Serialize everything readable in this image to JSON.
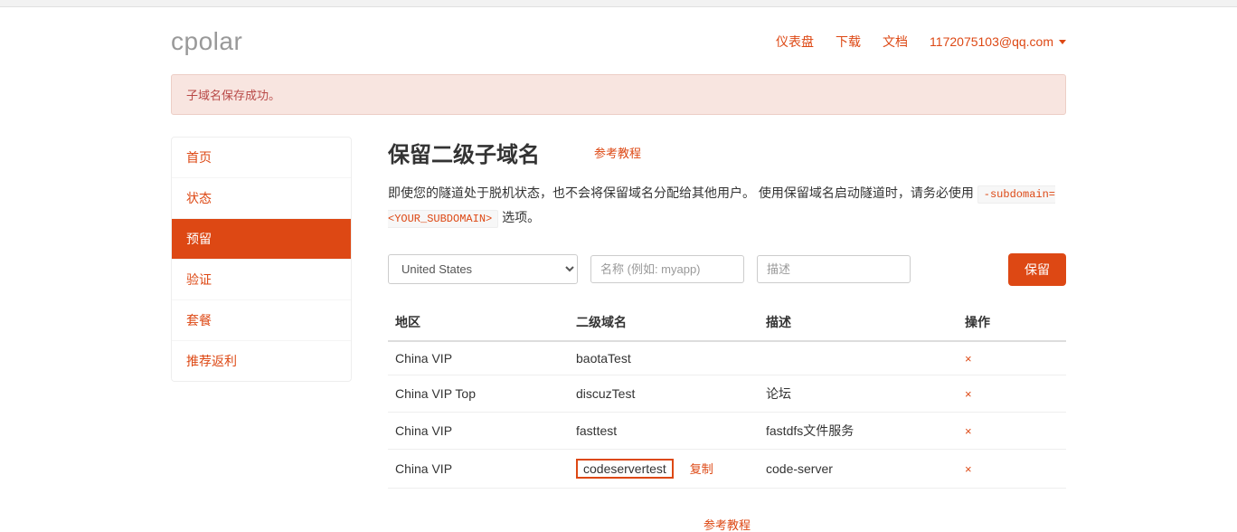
{
  "brand": "cpolar",
  "nav": {
    "dashboard": "仪表盘",
    "download": "下载",
    "docs": "文档",
    "user": "1172075103@qq.com"
  },
  "alert": "子域名保存成功。",
  "sidebar": {
    "items": [
      {
        "label": "首页"
      },
      {
        "label": "状态"
      },
      {
        "label": "预留"
      },
      {
        "label": "验证"
      },
      {
        "label": "套餐"
      },
      {
        "label": "推荐返利"
      }
    ]
  },
  "page": {
    "title": "保留二级子域名",
    "tutorial": "参考教程",
    "desc_pre": "即使您的隧道处于脱机状态，也不会将保留域名分配给其他用户。 使用保留域名启动隧道时，请务必使用 ",
    "desc_code": "-subdomain=<YOUR_SUBDOMAIN>",
    "desc_post": " 选项。"
  },
  "form": {
    "region_selected": "United States",
    "name_placeholder": "名称 (例如: myapp)",
    "desc_placeholder": "描述",
    "submit": "保留"
  },
  "table": {
    "headers": {
      "region": "地区",
      "subdomain": "二级域名",
      "desc": "描述",
      "action": "操作"
    },
    "rows": [
      {
        "region": "China VIP",
        "subdomain": "baotaTest",
        "desc": "",
        "highlight": false
      },
      {
        "region": "China VIP Top",
        "subdomain": "discuzTest",
        "desc": "论坛",
        "highlight": false
      },
      {
        "region": "China VIP",
        "subdomain": "fasttest",
        "desc": "fastdfs文件服务",
        "highlight": false
      },
      {
        "region": "China VIP",
        "subdomain": "codeservertest",
        "desc": "code-server",
        "highlight": true
      }
    ],
    "copy_label": "复制",
    "delete_label": "×"
  },
  "bottom_tutorial": "参考教程"
}
